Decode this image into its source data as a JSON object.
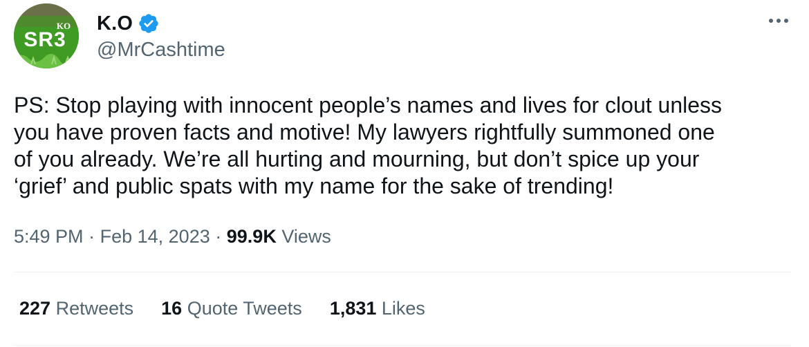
{
  "author": {
    "display_name": "K.O",
    "handle": "@MrCashtime",
    "avatar_text": "SR3",
    "avatar_badge": "KO",
    "verified_color": "#1d9bf0"
  },
  "tweet": {
    "text": "PS: Stop playing with innocent people’s names and lives for clout unless\nyou have proven facts and motive! My lawyers rightfully summoned one\nof you already. We’re all hurting and mourning, but don’t spice up your\n‘grief’ and public spats with my name for the sake of trending!",
    "time": "5:49 PM",
    "separator": "·",
    "date": "Feb 14, 2023",
    "views_count": "99.9K",
    "views_label": "Views"
  },
  "stats": {
    "retweets_count": "227",
    "retweets_label": "Retweets",
    "quotes_count": "16",
    "quotes_label": "Quote Tweets",
    "likes_count": "1,831",
    "likes_label": "Likes"
  },
  "icons": {
    "verified": "verified-badge-icon",
    "more": "more-options-icon"
  }
}
